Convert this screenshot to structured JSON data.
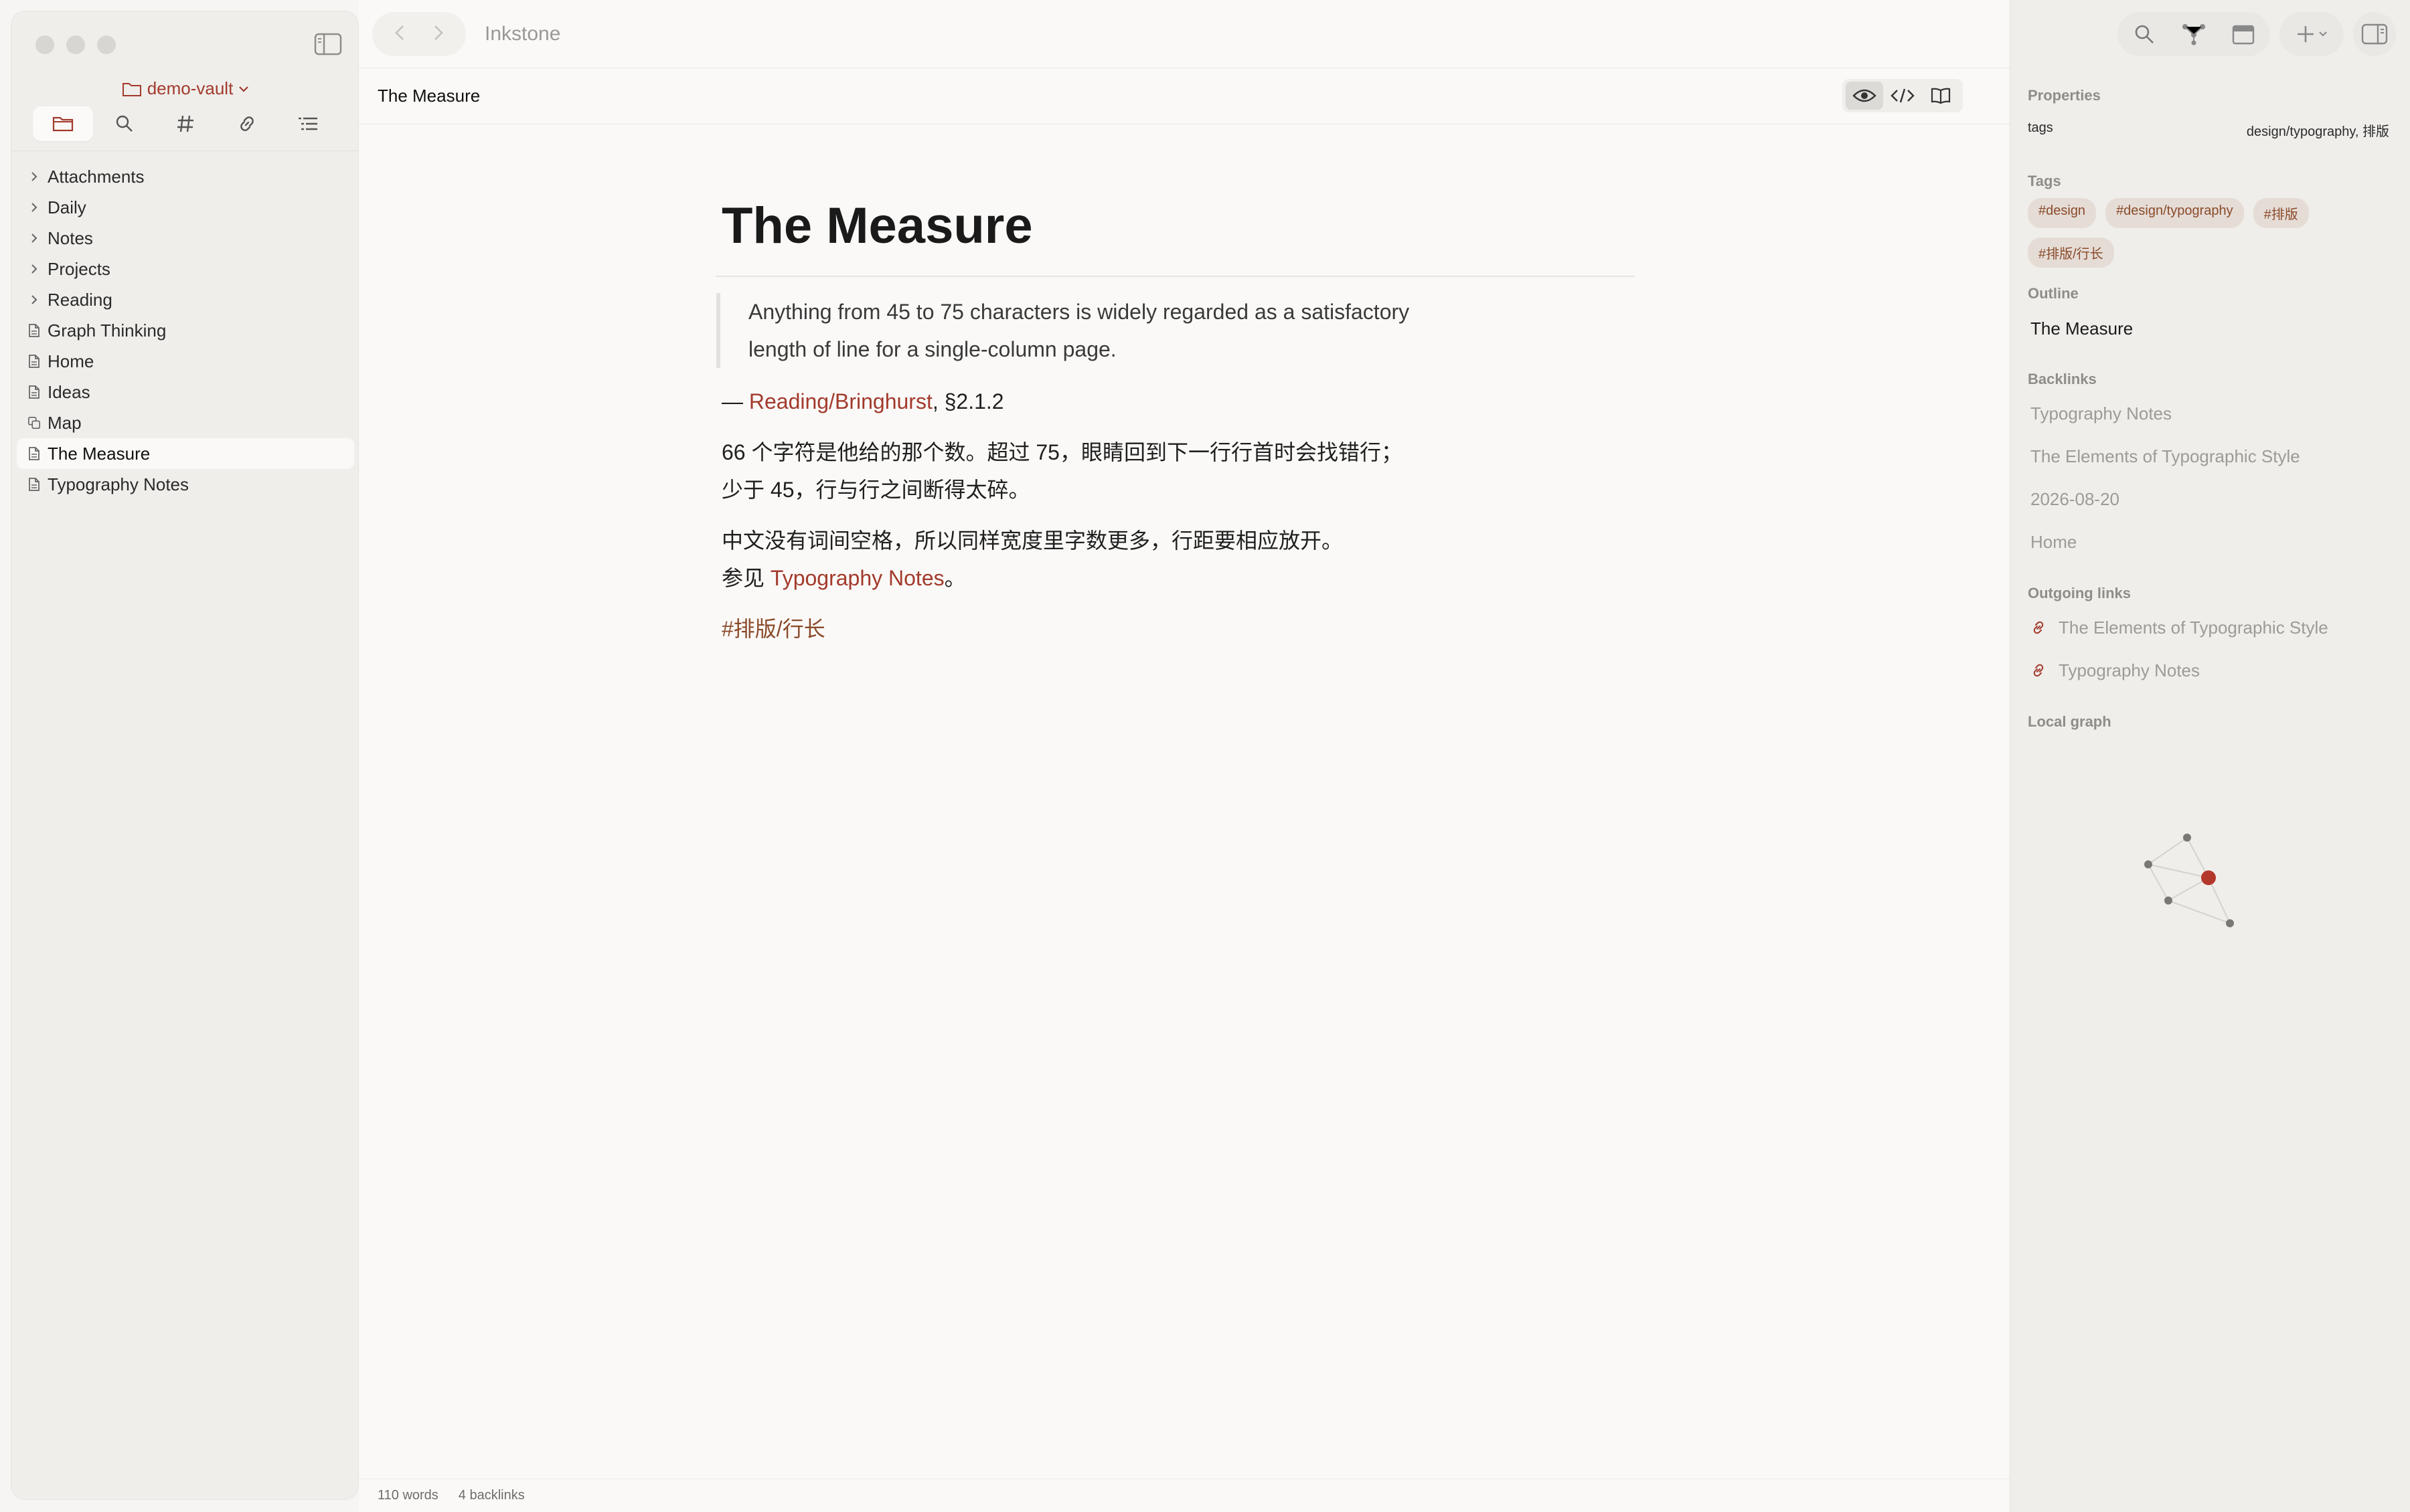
{
  "app": {
    "title": "Inkstone"
  },
  "sidebar": {
    "vault_name": "demo-vault",
    "tabs": [
      {
        "name": "files",
        "icon": "folder-icon"
      },
      {
        "name": "search",
        "icon": "search-icon"
      },
      {
        "name": "tags",
        "icon": "hash-icon"
      },
      {
        "name": "links",
        "icon": "link-icon"
      },
      {
        "name": "outline",
        "icon": "list-icon"
      }
    ],
    "tree": [
      {
        "label": "Attachments",
        "type": "folder"
      },
      {
        "label": "Daily",
        "type": "folder"
      },
      {
        "label": "Notes",
        "type": "folder"
      },
      {
        "label": "Projects",
        "type": "folder"
      },
      {
        "label": "Reading",
        "type": "folder"
      },
      {
        "label": "Graph Thinking",
        "type": "file"
      },
      {
        "label": "Home",
        "type": "file"
      },
      {
        "label": "Ideas",
        "type": "file"
      },
      {
        "label": "Map",
        "type": "canvas"
      },
      {
        "label": "The Measure",
        "type": "file",
        "selected": true
      },
      {
        "label": "Typography Notes",
        "type": "file"
      }
    ]
  },
  "doc": {
    "name": "The Measure",
    "title": "The Measure",
    "quote_line1": "Anything from 45 to 75 characters is widely regarded as a satisfactory",
    "quote_line2": "length of line for a single-column page.",
    "attribution_prefix": "— ",
    "attribution_link": "Reading/Bringhurst",
    "attribution_suffix": ", §2.1.2",
    "para1_line1": "66 个字符是他给的那个数。超过 75，眼睛回到下一行行首时会找错行；",
    "para1_line2": "少于 45，行与行之间断得太碎。",
    "para2_line1": "中文没有词间空格，所以同样宽度里字数更多，行距要相应放开。",
    "para2_prefix": "参见 ",
    "para2_link": "Typography Notes",
    "para2_suffix": "。",
    "tag": "#排版/行长"
  },
  "status": {
    "words": "110 words",
    "backlinks": "4 backlinks"
  },
  "right_panel": {
    "properties_label": "Properties",
    "prop_key": "tags",
    "prop_value": "design/typography, 排版",
    "tags_label": "Tags",
    "tags": [
      "#design",
      "#design/typography",
      "#排版",
      "#排版/行长"
    ],
    "outline_label": "Outline",
    "outline": [
      "The Measure"
    ],
    "backlinks_label": "Backlinks",
    "backlinks": [
      "Typography Notes",
      "The Elements of Typographic Style",
      "2026-08-20",
      "Home"
    ],
    "outgoing_label": "Outgoing links",
    "outgoing": [
      "The Elements of Typographic Style",
      "Typography Notes"
    ],
    "local_graph_label": "Local graph"
  },
  "colors": {
    "accent": "#a23a2c",
    "tag_text": "#8a4a2a",
    "tag_bg": "#e5dcd6"
  }
}
